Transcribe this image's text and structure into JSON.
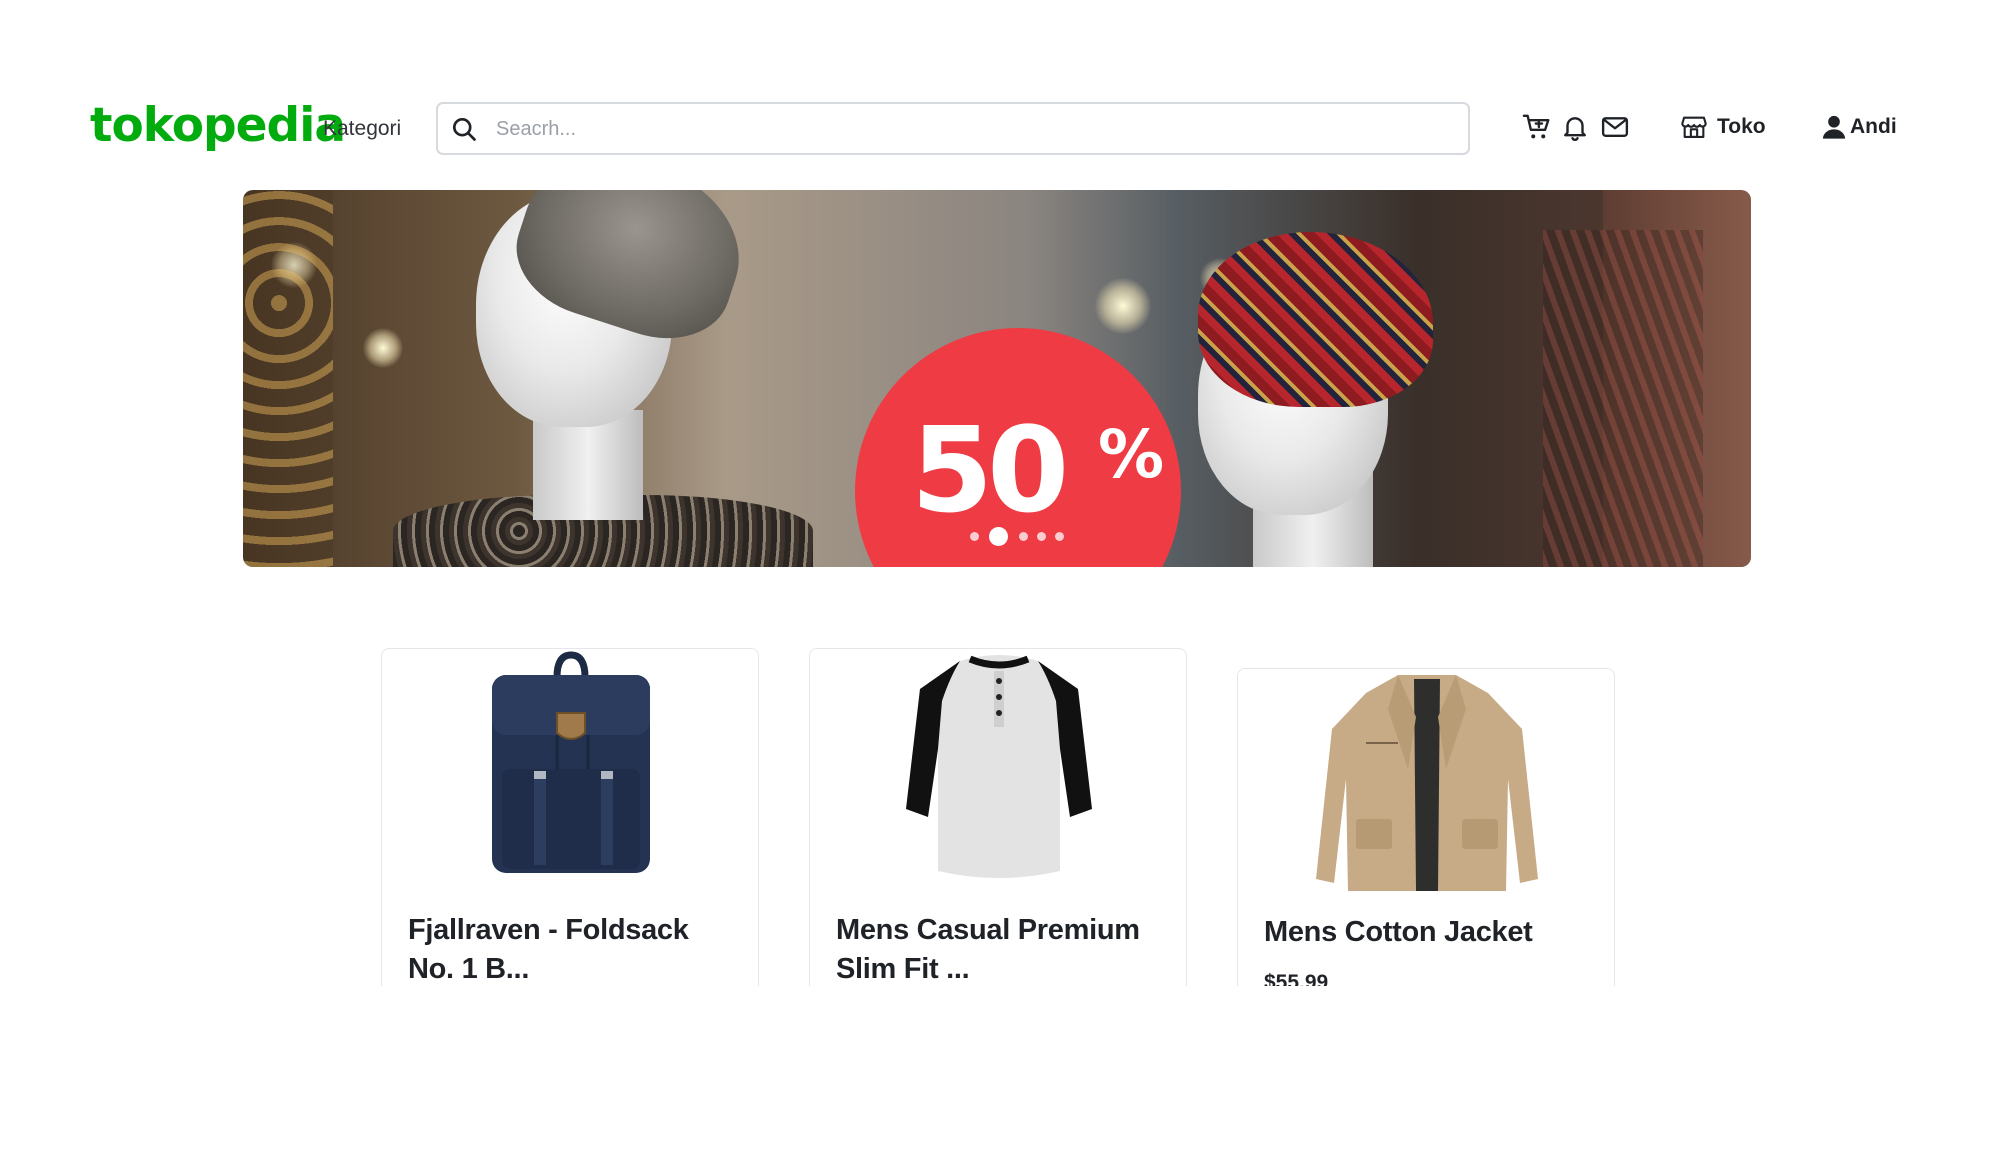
{
  "header": {
    "logo_text": "tokopedia",
    "kategori_label": "Kategori",
    "search": {
      "placeholder": "Seacrh...",
      "value": ""
    },
    "icons": [
      "cart-icon",
      "bell-icon",
      "mail-icon"
    ],
    "toko_label": "Toko",
    "user_name": "Andi"
  },
  "banner": {
    "sale_number": "50",
    "sale_percent": "%",
    "carousel": {
      "slide_count": 5,
      "active_index": 1
    }
  },
  "products": [
    {
      "title": "Fjallraven - Foldsack No. 1 B...",
      "price": ""
    },
    {
      "title": "Mens Casual Premium Slim Fit ...",
      "price": ""
    },
    {
      "title": "Mens Cotton Jacket",
      "price": "$55.99"
    }
  ],
  "colors": {
    "brand": "#03AC0E",
    "sale_red": "#ef3b44",
    "text": "#1f2328",
    "border": "#e4e6ea"
  }
}
